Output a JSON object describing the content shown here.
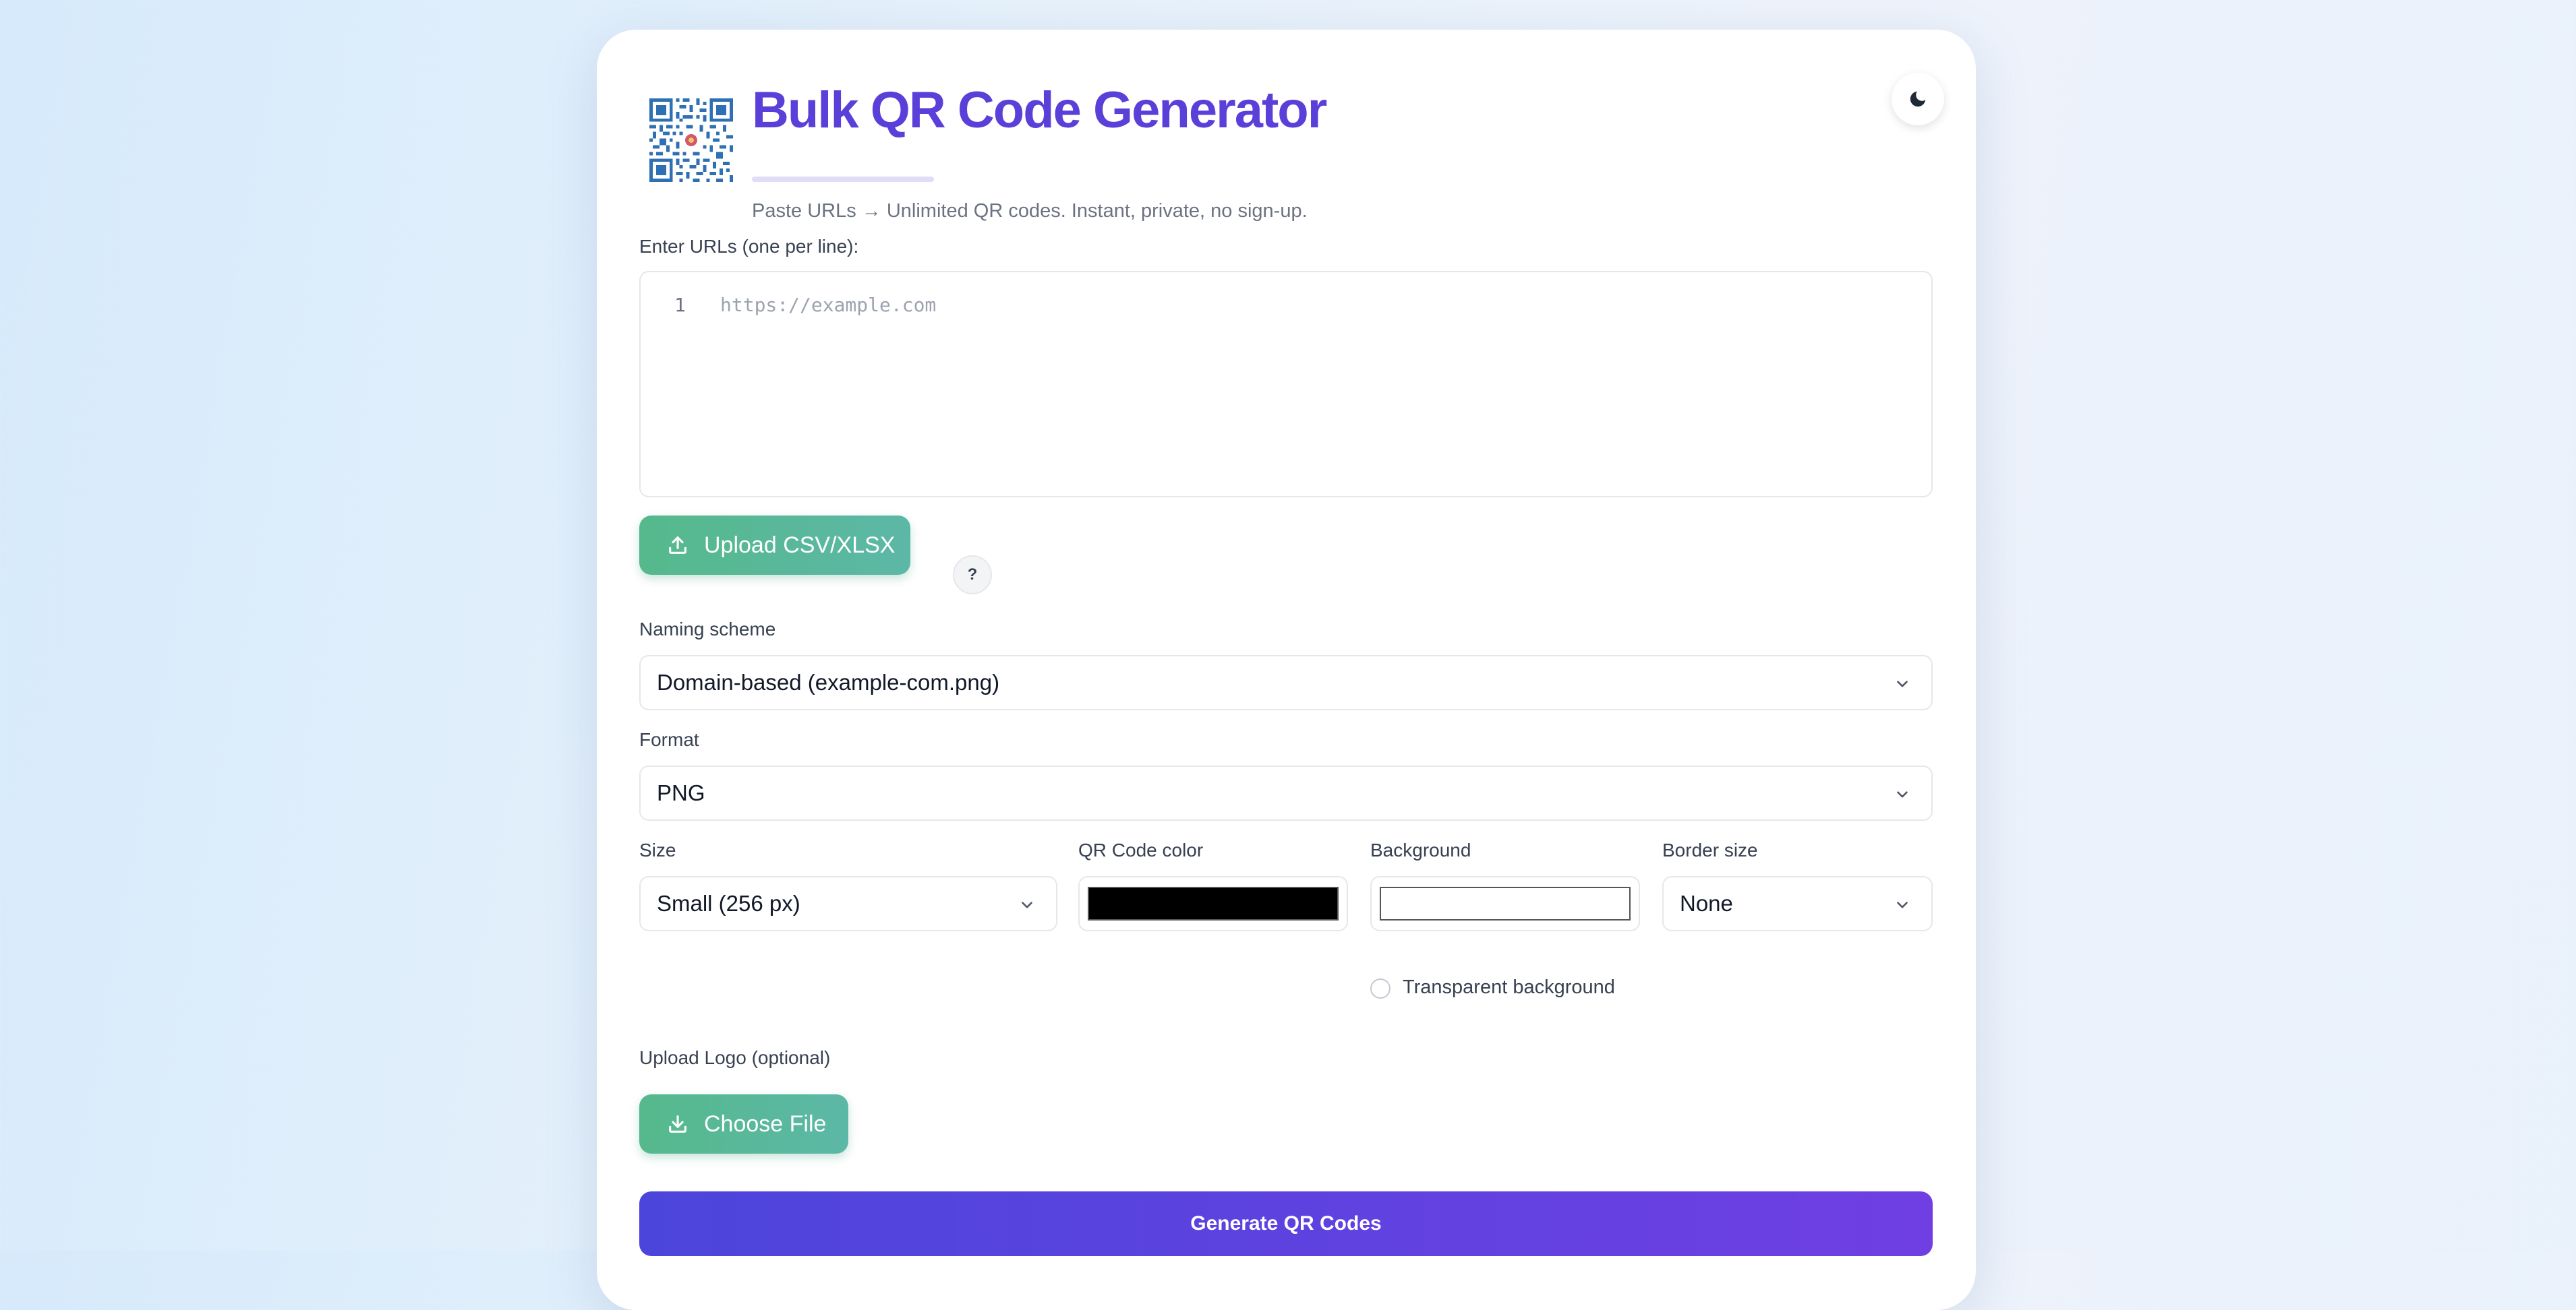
{
  "header": {
    "title": "Bulk QR Code Generator",
    "subtitle": "Paste URLs → Unlimited QR codes. Instant, private, no sign-up.",
    "logo_icon": "qr-code-logo-icon",
    "theme_toggle_icon": "moon-icon"
  },
  "urls": {
    "label": "Enter URLs (one per line):",
    "line_number": "1",
    "placeholder": "https://example.com",
    "value": ""
  },
  "upload_csv": {
    "label": "Upload CSV/XLSX",
    "icon": "upload-icon",
    "help_label": "?"
  },
  "naming": {
    "label": "Naming scheme",
    "selected": "Domain-based (example-com.png)"
  },
  "format": {
    "label": "Format",
    "selected": "PNG"
  },
  "size": {
    "label": "Size",
    "selected": "Small (256 px)"
  },
  "qr_color": {
    "label": "QR Code color",
    "value": "#000000"
  },
  "background": {
    "label": "Background",
    "value": "#ffffff",
    "transparent_label": "Transparent background"
  },
  "border": {
    "label": "Border size",
    "selected": "None"
  },
  "logo_upload": {
    "label": "Upload Logo (optional)",
    "button_label": "Choose File",
    "icon": "download-icon"
  },
  "generate": {
    "label": "Generate QR Codes"
  },
  "colors": {
    "accent": "#5b3fd9",
    "green": "#55b98c",
    "generate_start": "#4c45dc",
    "generate_end": "#6f3fe3"
  }
}
